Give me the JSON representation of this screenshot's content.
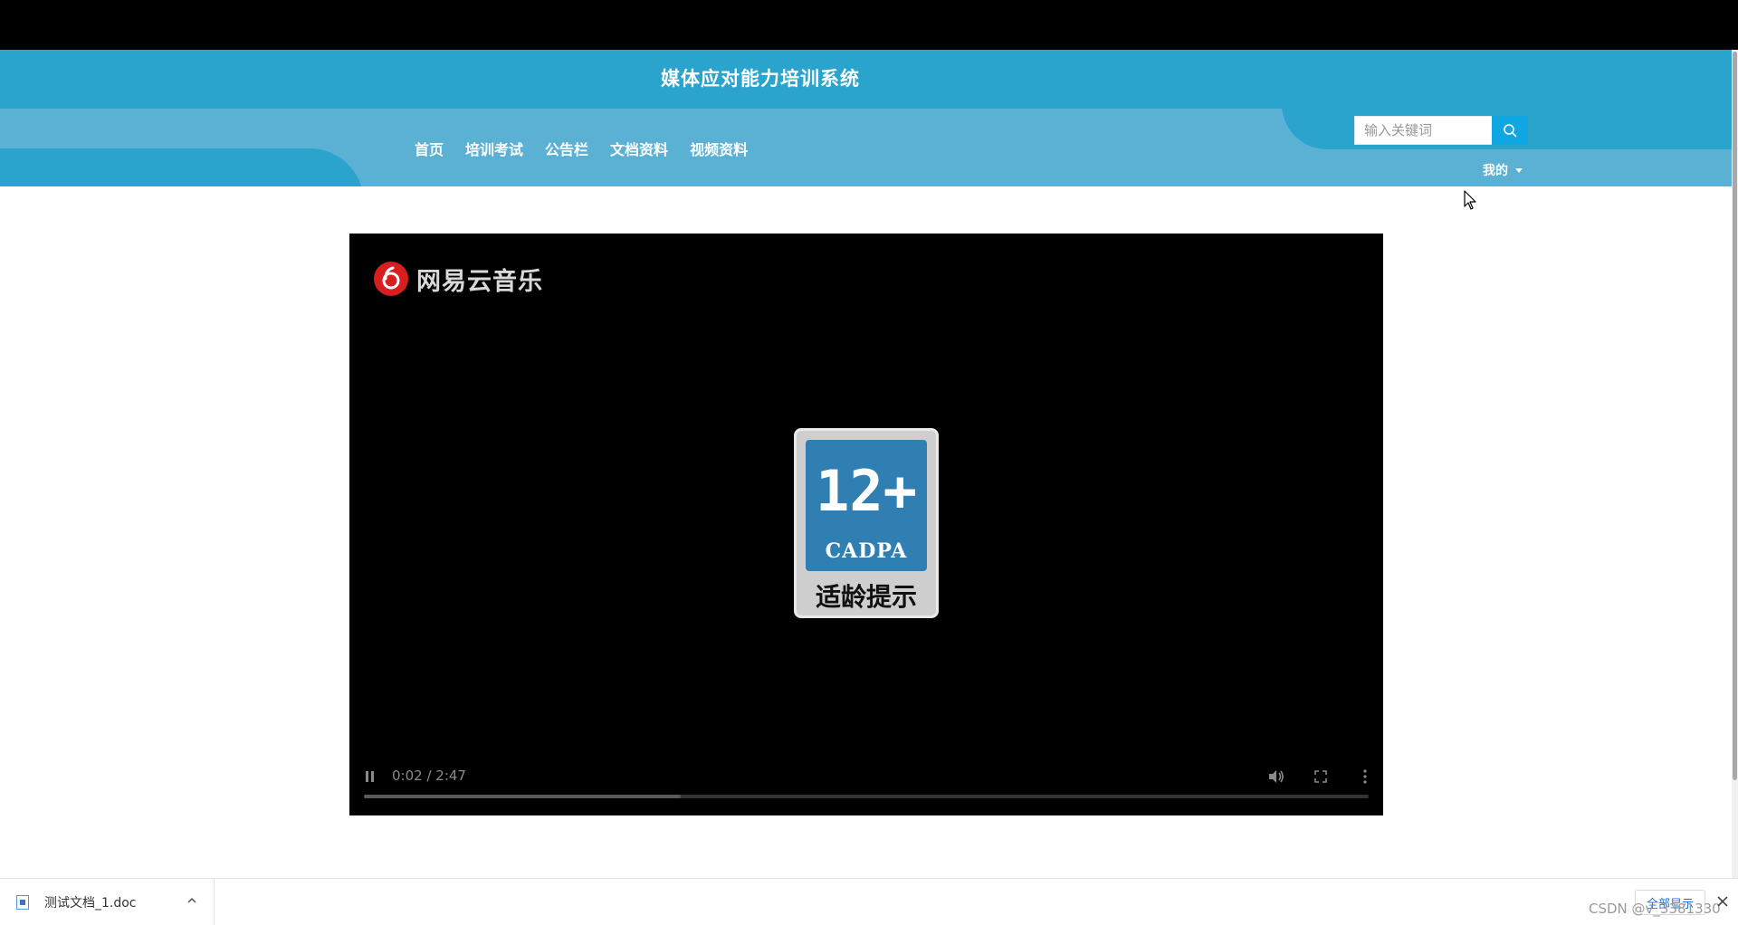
{
  "header": {
    "title": "媒体应对能力培训系统",
    "nav": [
      {
        "label": "首页"
      },
      {
        "label": "培训考试"
      },
      {
        "label": "公告栏"
      },
      {
        "label": "文档资料"
      },
      {
        "label": "视频资料"
      }
    ],
    "search_placeholder": "输入关键词",
    "my_menu_label": "我的"
  },
  "video": {
    "watermark": "网易云音乐",
    "age_rating": {
      "number": "12+",
      "org": "CADPA",
      "caption": "适龄提示"
    },
    "time_display": "0:02 / 2:47",
    "progress": 0.315
  },
  "download_bar": {
    "file_name": "测试文档_1.doc",
    "show_all_label": "全部显示",
    "watermark": "CSDN @v_3381330"
  },
  "colors": {
    "header_dark": "#2aa3cd",
    "header_light": "#5ab1d3",
    "search_button": "#10a6e1"
  }
}
